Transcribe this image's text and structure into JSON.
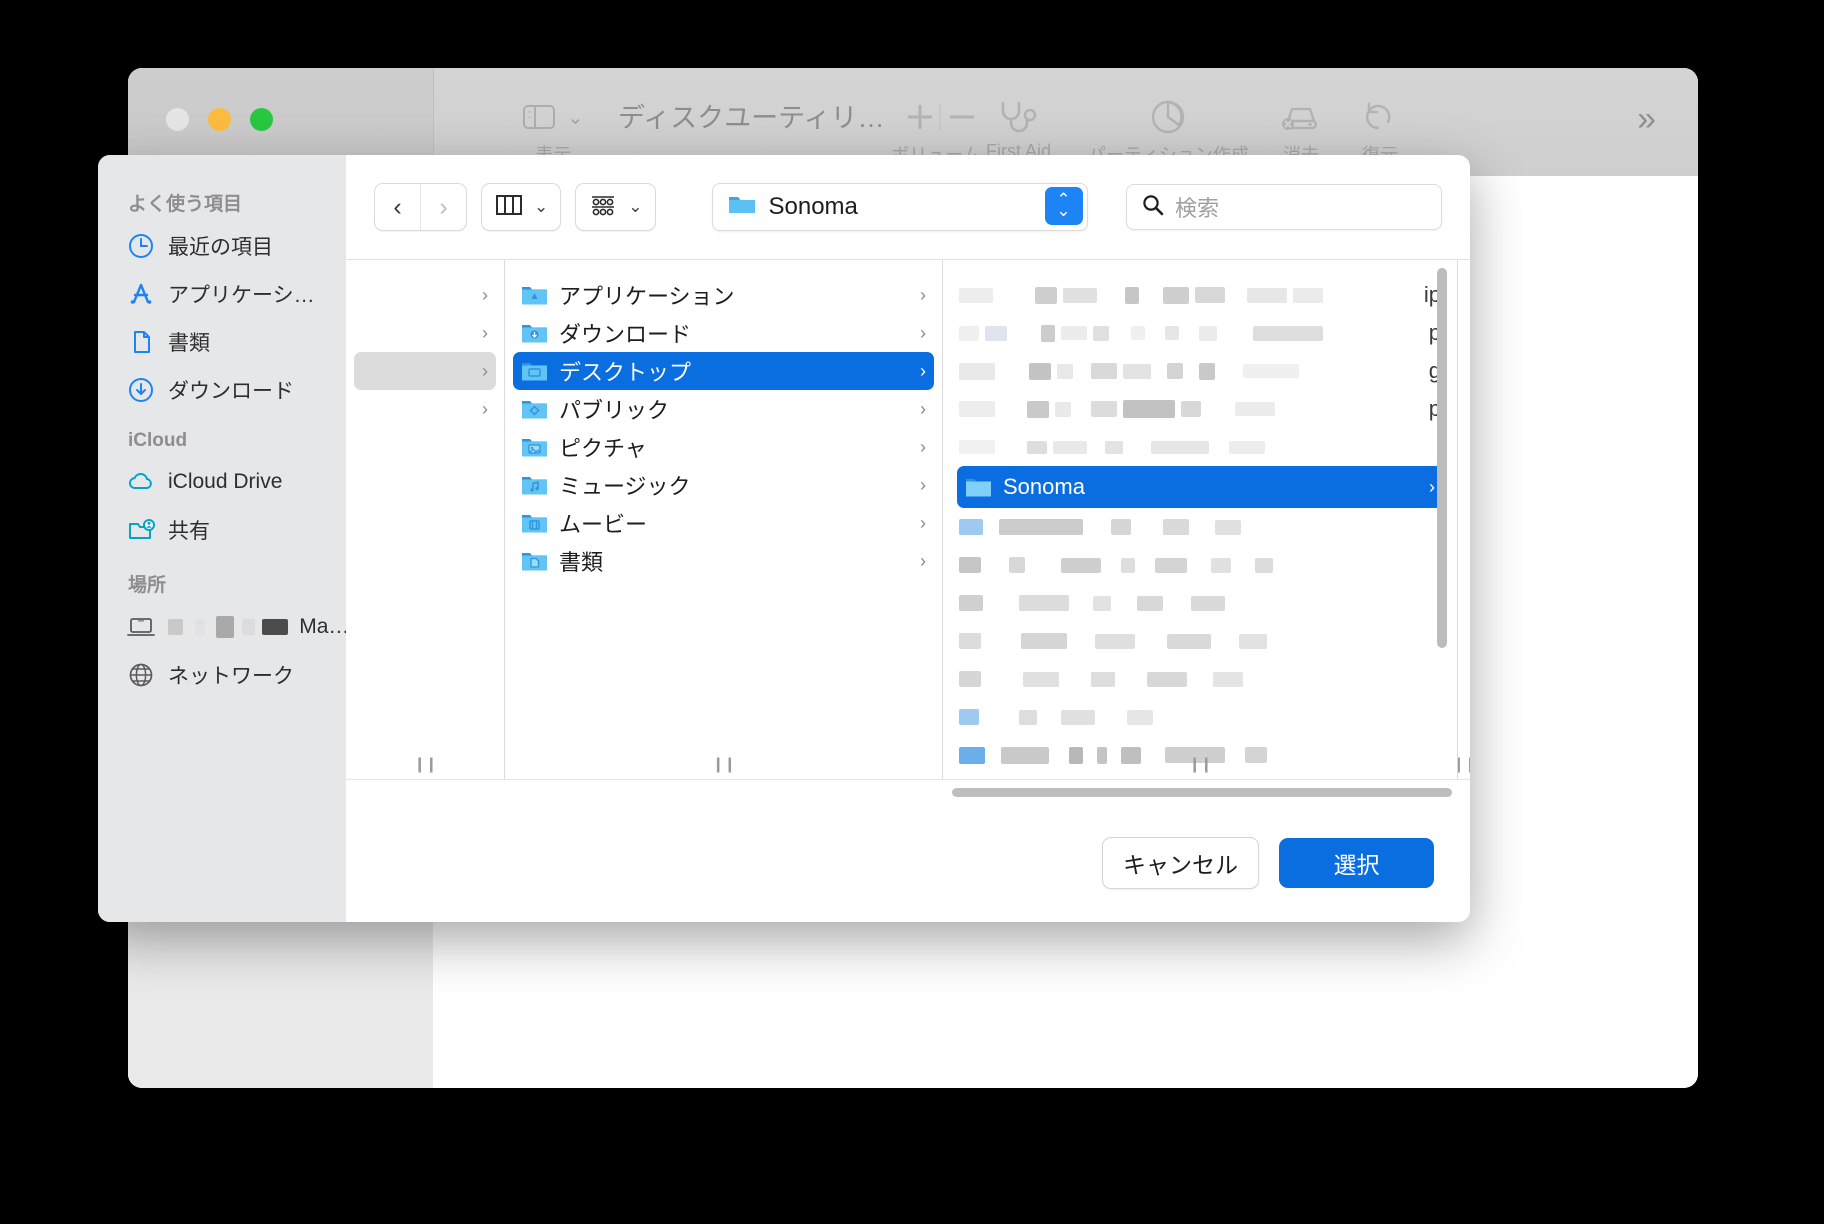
{
  "app_window": {
    "title": "ディスクユーティリ…",
    "traffic_lights": [
      "close",
      "minimize",
      "zoom"
    ],
    "toolbar": {
      "view_label": "表示",
      "items": [
        {
          "label": "ボリューム",
          "icon": "plus-minus-icon"
        },
        {
          "label": "First Aid",
          "icon": "stethoscope-icon"
        },
        {
          "label": "パーティション作成",
          "icon": "pie-chart-icon"
        },
        {
          "label": "消去",
          "icon": "erase-disk-icon"
        },
        {
          "label": "復元",
          "icon": "restore-icon"
        }
      ],
      "overflow_label": "»"
    }
  },
  "sheet": {
    "sidebar": {
      "groups": [
        {
          "title": "よく使う項目",
          "items": [
            {
              "label": "最近の項目",
              "icon": "clock-icon"
            },
            {
              "label": "アプリケーシ…",
              "icon": "applications-icon"
            },
            {
              "label": "書類",
              "icon": "document-icon"
            },
            {
              "label": "ダウンロード",
              "icon": "download-icon"
            }
          ]
        },
        {
          "title": "iCloud",
          "items": [
            {
              "label": "iCloud Drive",
              "icon": "cloud-icon"
            },
            {
              "label": "共有",
              "icon": "shared-folder-icon"
            }
          ]
        },
        {
          "title": "場所",
          "items": [
            {
              "label": "Ma…",
              "icon": "laptop-icon",
              "redacted": true
            },
            {
              "label": "ネットワーク",
              "icon": "globe-icon"
            }
          ]
        }
      ]
    },
    "nav": {
      "back_label": "‹",
      "forward_label": "›",
      "view_mode_icon": "column-view-icon",
      "group_icon": "group-view-icon",
      "chevron": "⌄",
      "path_value": "Sonoma",
      "path_icon": "folder-icon",
      "stepper_up": "⌃",
      "stepper_down": "⌄",
      "search_placeholder": "検索",
      "search_value": "",
      "search_icon": "search-icon"
    },
    "columns": {
      "col1_rows": [
        {
          "label": "",
          "disclosure": "›",
          "selected": false,
          "grey": false
        },
        {
          "label": "",
          "disclosure": "›",
          "selected": false,
          "grey": false
        },
        {
          "label": "",
          "disclosure": "›",
          "selected": false,
          "grey": true
        },
        {
          "label": "",
          "disclosure": "›",
          "selected": false,
          "grey": false
        }
      ],
      "col2_rows": [
        {
          "label": "アプリケーション",
          "icon": "folder-applications-icon",
          "disclosure": "›",
          "selected": false
        },
        {
          "label": "ダウンロード",
          "icon": "folder-downloads-icon",
          "disclosure": "›",
          "selected": false
        },
        {
          "label": "デスクトップ",
          "icon": "folder-desktop-icon",
          "disclosure": "›",
          "selected": true
        },
        {
          "label": "パブリック",
          "icon": "folder-public-icon",
          "disclosure": "›",
          "selected": false
        },
        {
          "label": "ピクチャ",
          "icon": "folder-pictures-icon",
          "disclosure": "›",
          "selected": false
        },
        {
          "label": "ミュージック",
          "icon": "folder-music-icon",
          "disclosure": "›",
          "selected": false
        },
        {
          "label": "ムービー",
          "icon": "folder-movies-icon",
          "disclosure": "›",
          "selected": false
        },
        {
          "label": "書類",
          "icon": "folder-documents-icon",
          "disclosure": "›",
          "selected": false
        }
      ],
      "col3_rows": [
        {
          "label": "",
          "redacted": true,
          "tail": "ip",
          "selected": false
        },
        {
          "label": "",
          "redacted": true,
          "tail": "p",
          "selected": false
        },
        {
          "label": "",
          "redacted": true,
          "tail": "g",
          "selected": false
        },
        {
          "label": "",
          "redacted": true,
          "tail": "p",
          "selected": false
        },
        {
          "label": "",
          "redacted": true,
          "tail": "",
          "selected": false
        },
        {
          "label": "Sonoma",
          "redacted": false,
          "tail": "",
          "selected": true,
          "icon": "folder-icon",
          "disclosure": "›"
        },
        {
          "label": "",
          "redacted": true,
          "tail": "",
          "selected": false
        },
        {
          "label": "",
          "redacted": true,
          "tail": "",
          "selected": false
        },
        {
          "label": "",
          "redacted": true,
          "tail": "",
          "selected": false
        },
        {
          "label": "",
          "redacted": true,
          "tail": "",
          "selected": false
        },
        {
          "label": "",
          "redacted": true,
          "tail": "",
          "selected": false
        },
        {
          "label": "",
          "redacted": true,
          "tail": "",
          "selected": false
        },
        {
          "label": "",
          "redacted": true,
          "tail": "",
          "selected": false
        },
        {
          "label": "",
          "redacted": true,
          "tail": "",
          "selected": false
        }
      ]
    },
    "footer": {
      "cancel_label": "キャンセル",
      "select_label": "選択"
    }
  },
  "colors": {
    "accent_blue": "#0a6ee1",
    "stepper_blue": "#1d84f5",
    "sidebar_bg": "#e6e7e8",
    "titlebar_grey": "#d4d4d4",
    "icon_blue": "#1d84f5",
    "icloud_teal": "#07a3c4"
  }
}
